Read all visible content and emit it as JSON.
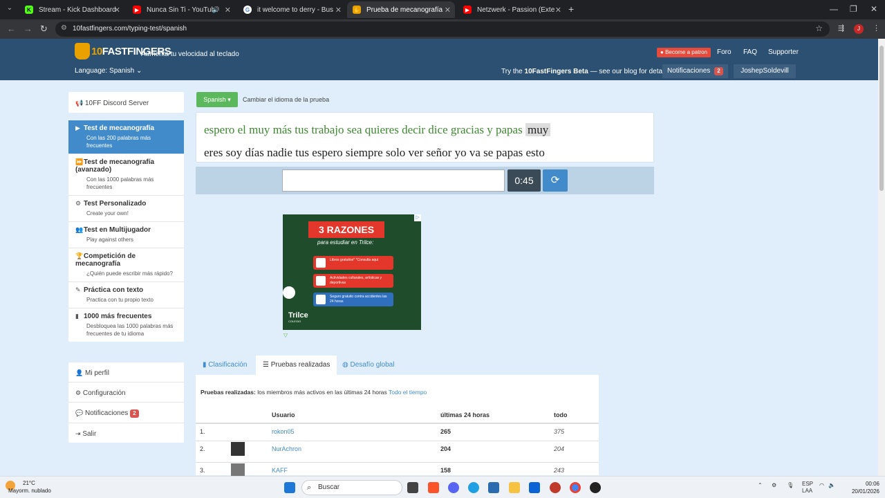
{
  "browser": {
    "tabs": [
      {
        "title": "Stream - Kick Dashboard",
        "color": "#53fc18",
        "glyph": "K"
      },
      {
        "title": "Nunca Sin Ti - YouTube",
        "color": "#ff0000",
        "glyph": "▶"
      },
      {
        "title": "it welcome to derry - Buscar co",
        "color": "#4285f4",
        "glyph": "G"
      },
      {
        "title": "Prueba de mecanografía Spani",
        "color": "#e9a100",
        "glyph": "✋"
      },
      {
        "title": "Netzwerk - Passion (Extended",
        "color": "#ff0000",
        "glyph": "▶"
      }
    ],
    "url": "10fastfingers.com/typing-test/spanish",
    "profile_initial": "J"
  },
  "header": {
    "logo": "FASTFINGERS",
    "logo_prefix": "10",
    "tagline": "Aumenta tu velocidad al teclado",
    "patron": "Become a patron",
    "links": [
      "Foro",
      "FAQ",
      "Supporter"
    ],
    "language": "Language: Spanish",
    "beta_prefix": "Try the ",
    "beta_bold": "10FastFingers Beta",
    "beta_suffix": " — see our blog for details",
    "notifications": "Notificaciones",
    "notif_count": "2",
    "username": "JoshepSoldevill"
  },
  "sidebar": {
    "discord": "10FF Discord Server",
    "items": [
      {
        "title": "Test de mecanografía",
        "sub": "Con las 200 palabras más frecuentes",
        "icon": "▶"
      },
      {
        "title": "Test de mecanografía (avanzado)",
        "sub": "Con las 1000 palabras más frecuentes",
        "icon": "⏩"
      },
      {
        "title": "Test Personalizado",
        "sub": "Create your own!",
        "icon": "⚙"
      },
      {
        "title": "Test en Multijugador",
        "sub": "Play against others",
        "icon": "👥"
      },
      {
        "title": "Competición de mecanografía",
        "sub": "¿Quién puede escribir más rápido?",
        "icon": "🏆"
      },
      {
        "title": "Práctica con texto",
        "sub": "Practica con tu propio texto",
        "icon": "✎"
      },
      {
        "title": "1000 más frecuentes",
        "sub": "Desbloquea las 1000 palabras más frecuentes de tu idioma",
        "icon": "▮"
      }
    ],
    "account": [
      {
        "label": "Mi perfil",
        "icon": "👤"
      },
      {
        "label": "Configuración",
        "icon": "⚙"
      },
      {
        "label": "Notificaciones",
        "icon": "💬",
        "badge": "2"
      },
      {
        "label": "Salir",
        "icon": "⇥"
      }
    ]
  },
  "test": {
    "language_button": "Spanish ▾",
    "change_language": "Cambiar el idioma de la prueba",
    "typed_words": "espero el muy más tus trabajo sea quieres decir dice gracias y papas",
    "current_word": "muy",
    "next_words": "eres soy días nadie tus espero siempre solo ver señor yo va se papas esto",
    "timer": "0:45",
    "input_value": ""
  },
  "ad": {
    "headline": "3 RAZONES",
    "sub": "para estudiar en Trilce:",
    "cards": [
      {
        "text": "Libros gratuitos* *Consulta aqui",
        "color": "#e3372b"
      },
      {
        "text": "Actividades culturales, artísticas y deportivas",
        "color": "#e3372b"
      },
      {
        "text": "Seguro gratuito contra accidentes las 24 horas",
        "color": "#2f6fbe"
      }
    ],
    "brand": "Trilce",
    "brand_sub": "COLEGIO"
  },
  "stats": {
    "tabs": [
      "Clasificación",
      "Pruebas realizadas",
      "Desafío global"
    ],
    "active_tab": 1,
    "desc_bold": "Pruebas realizadas:",
    "desc_text": " los miembros más activos en las últimas 24 horas ",
    "desc_link": "Todo el tiempo",
    "headers": {
      "user": "Usuario",
      "last24": "últimas 24 horas",
      "all": "todo"
    },
    "rows": [
      {
        "rank": "1.",
        "user": "rokon05",
        "last24": "265",
        "all": "375",
        "avatar": false
      },
      {
        "rank": "2.",
        "user": "NurAchron",
        "last24": "204",
        "all": "204",
        "avatar": true
      },
      {
        "rank": "3.",
        "user": "KAFF",
        "last24": "158",
        "all": "243",
        "avatar": true
      }
    ]
  },
  "taskbar": {
    "temp": "21°C",
    "weather": "Mayorm. nublado",
    "search": "Buscar",
    "lang": "ESP",
    "lang2": "LAA",
    "time": "00:06",
    "date": "20/01/2026"
  }
}
